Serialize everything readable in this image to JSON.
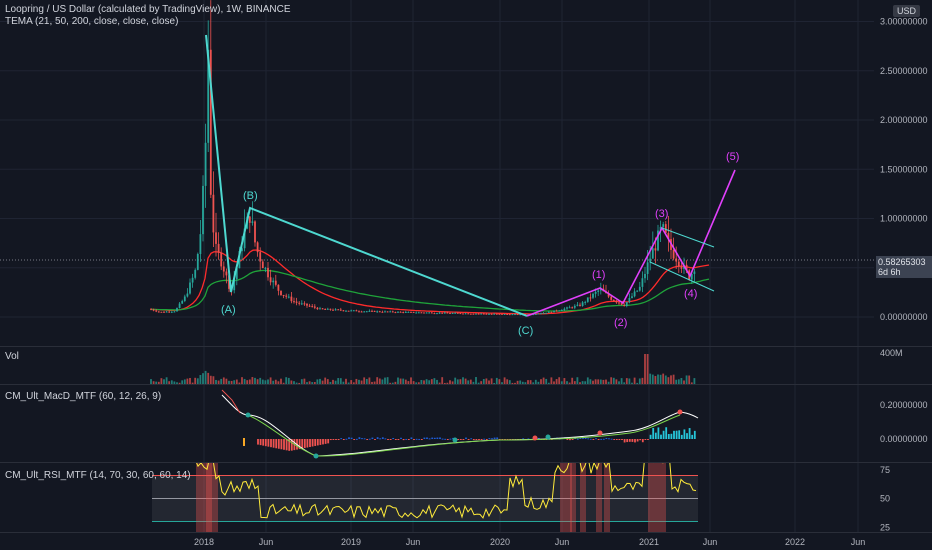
{
  "header": {
    "title": "Loopring / US Dollar (calculated by TradingView), 1W, BINANCE",
    "indicator": "TEMA (21, 50, 200, close, close, close)",
    "currency": "USD"
  },
  "price_badge": {
    "value": "0.58265303",
    "countdown": "6d 6h"
  },
  "price_axis": [
    "3.00000000",
    "2.50000000",
    "2.00000000",
    "1.50000000",
    "1.00000000",
    "0.50000000",
    "0.00000000"
  ],
  "volume": {
    "label": "Vol",
    "axis": "400M"
  },
  "macd": {
    "label": "CM_Ult_MacD_MTF (60, 12, 26, 9)",
    "axis": [
      "0.20000000",
      "0.00000000"
    ]
  },
  "rsi": {
    "label": "CM_Ult_RSI_MTF (14, 70, 30, 60, 60, 14)",
    "axis": [
      "75",
      "50",
      "25"
    ]
  },
  "time_axis": [
    "2018",
    "Jun",
    "2019",
    "Jun",
    "2020",
    "Jun",
    "2021",
    "Jun",
    "2022",
    "Jun"
  ],
  "wave_labels": {
    "A": "(A)",
    "B": "(B)",
    "C": "(C)",
    "w1": "(1)",
    "w2": "(2)",
    "w3": "(3)",
    "w4": "(4)",
    "w5": "(5)"
  },
  "colors": {
    "background": "#131722",
    "up": "#26a69a",
    "down": "#ef5350",
    "abc_wave": "#4ed8d0",
    "impulse_wave": "#e040fb",
    "tema_fast": "#ff2b2b",
    "tema_slow": "#1fa33a",
    "rsi_line": "#ffeb3b"
  }
}
